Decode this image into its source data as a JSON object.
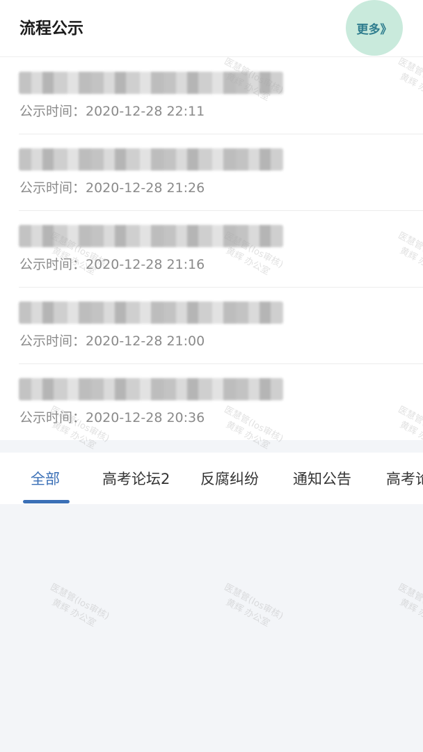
{
  "section": {
    "title": "流程公示",
    "more_label": "更多》"
  },
  "notices": [
    {
      "title": "",
      "time": "公示时间：2020-12-28 22:11"
    },
    {
      "title": "",
      "time": "公示时间：2020-12-28 21:26"
    },
    {
      "title": "",
      "time": "公示时间：2020-12-28 21:16"
    },
    {
      "title": "",
      "time": "公示时间：2020-12-28 21:00"
    },
    {
      "title": "",
      "time": "公示时间：2020-12-28 20:36"
    }
  ],
  "tabs": [
    {
      "label": "全部",
      "active": true
    },
    {
      "label": "高考论坛2",
      "active": false
    },
    {
      "label": "反腐纠纷",
      "active": false
    },
    {
      "label": "通知公告",
      "active": false
    },
    {
      "label": "高考论坛",
      "active": false
    }
  ],
  "watermark": {
    "line1": "医慧管(Ios审核)",
    "line2": "黄辉 办公室"
  },
  "colors": {
    "accent": "#3a6fb6",
    "more_bg": "#c9eadc",
    "more_text": "#2f7d8e"
  }
}
